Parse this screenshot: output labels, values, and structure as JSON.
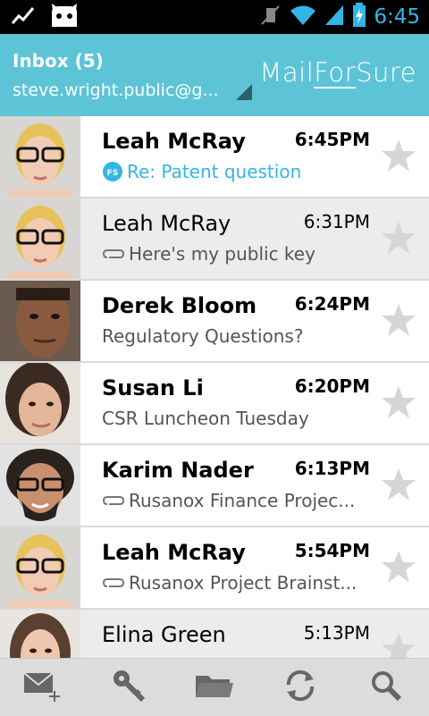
{
  "status": {
    "time": "6:45"
  },
  "header": {
    "inbox_title": "Inbox (5)",
    "account_email": "steve.wright.public@g...",
    "brand_mail": "Mail",
    "brand_for": "For",
    "brand_sure": "Sure"
  },
  "messages": [
    {
      "sender": "Leah McRay",
      "time": "6:45PM",
      "subject": "Re: Patent question",
      "unread": true,
      "icon": "fs-badge-icon"
    },
    {
      "sender": "Leah McRay",
      "time": "6:31PM",
      "subject": "Here's my public key",
      "unread": false,
      "icon": "paperclip-icon"
    },
    {
      "sender": "Derek Bloom",
      "time": "6:24PM",
      "subject": "Regulatory Questions?",
      "unread": true,
      "icon": ""
    },
    {
      "sender": "Susan Li",
      "time": "6:20PM",
      "subject": "CSR Luncheon Tuesday",
      "unread": true,
      "icon": ""
    },
    {
      "sender": "Karim Nader",
      "time": "6:13PM",
      "subject": "Rusanox Finance Projec...",
      "unread": true,
      "icon": "paperclip-icon"
    },
    {
      "sender": "Leah McRay",
      "time": "5:54PM",
      "subject": "Rusanox Project Brainst...",
      "unread": true,
      "icon": "paperclip-icon"
    },
    {
      "sender": "Elina Green",
      "time": "5:13PM",
      "subject": "",
      "unread": false,
      "icon": ""
    }
  ],
  "fs_badge": "FS",
  "colors": {
    "header": "#5cc4d6",
    "accent": "#33b5e5",
    "read_row": "#ececec",
    "star": "#d6d6d6"
  },
  "toolbar": {
    "icons": [
      "compose-icon",
      "key-icon",
      "folder-icon",
      "refresh-icon",
      "search-icon"
    ]
  }
}
